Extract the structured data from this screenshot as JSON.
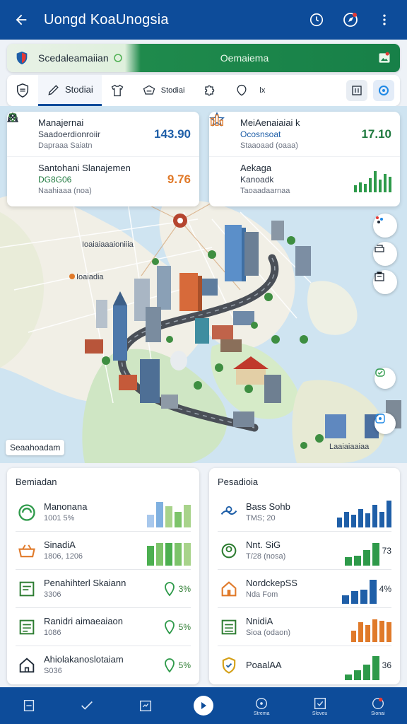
{
  "header": {
    "title": "Uongd KoaUnogsia",
    "icons": [
      "back-arrow-icon",
      "clock-icon",
      "compass-icon",
      "more-vert-icon"
    ]
  },
  "banner": {
    "left_label": "Scedaleamaiian",
    "center_label": "Oemaiema"
  },
  "tabs": [
    {
      "label": "Stodiai",
      "icon": "pencil-icon",
      "active": true
    },
    {
      "label": "",
      "icon": "shirt-icon"
    },
    {
      "label": "Stodiai",
      "icon": "cart-icon"
    },
    {
      "label": "",
      "icon": "puzzle-icon"
    },
    {
      "label": "lx",
      "icon": "shield-outline-icon"
    }
  ],
  "map_stats": {
    "left": [
      {
        "title": "Manajernai",
        "line2": "Saadoerdionroiir",
        "line3": "Dapraaa Saiatn",
        "value": "143.90",
        "value_color": "#1f5fa8"
      },
      {
        "title": "Santohani Slanajemen",
        "line2": "DG8G06",
        "line3": "Naahiaaa (noa)",
        "value": "9.76",
        "value_color": "#e07a2a"
      }
    ],
    "right": [
      {
        "title": "MeiAenaiaiai k",
        "line2": "Ocosnsoat",
        "line3": "Staaoaad (oaaa)",
        "value": "17.10",
        "value_color": "#1f7a3f"
      },
      {
        "title": "Aekaga",
        "line2": "Kanoadk",
        "line3": "Taoaadaarnaa",
        "value": ""
      }
    ]
  },
  "map": {
    "place_labels": [
      "Ioaiaiaaaioniiia",
      "Ioaiadia",
      "Laaiaiaaiaa"
    ],
    "chip_label": "Seaahoadam",
    "fab_icons": [
      "dots-icon",
      "layers-icon",
      "building-icon",
      "chat-icon",
      "location-icon"
    ]
  },
  "left_panel": {
    "title": "Bemiadan",
    "rows": [
      {
        "icon": "globe-icon",
        "title": "Manonana",
        "sub": "1001 5%",
        "pct": "",
        "bars": [
          0.45,
          0.9,
          0.75,
          0.55,
          0.8
        ],
        "colors": [
          "#a8c8ec",
          "#7fb0e0",
          "#a8d38b",
          "#7cc36a",
          "#a8d38b"
        ]
      },
      {
        "icon": "basket-icon",
        "title": "SinadiA",
        "sub": "1806, 1206",
        "pct": "",
        "bars": [
          0.7,
          0.8,
          0.8,
          0.8,
          0.8
        ],
        "colors": [
          "#4caf50",
          "#7cc36a",
          "#4caf50",
          "#7cc36a",
          "#a8d38b"
        ]
      },
      {
        "icon": "doc-icon",
        "title": "Penahihterl Skaiann",
        "sub": "3306",
        "pct": "3%",
        "bars": [],
        "colors": []
      },
      {
        "icon": "form-icon",
        "title": "Ranidri aimaeaiaon",
        "sub": "1086",
        "pct": "5%",
        "bars": [],
        "colors": []
      },
      {
        "icon": "house-icon",
        "title": "Ahiolakanoslotaiam",
        "sub": "S036",
        "pct": "5%",
        "bars": [],
        "colors": []
      }
    ]
  },
  "right_panel": {
    "title": "Pesadioia",
    "rows": [
      {
        "icon": "hands-icon",
        "title": "Bass Sohb",
        "sub": "TMS; 20",
        "pct": "",
        "bars": [
          0.35,
          0.55,
          0.45,
          0.65,
          0.5,
          0.8,
          0.55,
          0.95
        ],
        "colors": [
          "#1f5fa8",
          "#1f5fa8",
          "#1f5fa8",
          "#1f5fa8",
          "#1f5fa8",
          "#1f5fa8",
          "#1f5fa8",
          "#1f5fa8"
        ]
      },
      {
        "icon": "gear-person-icon",
        "title": "Nnt. SiG",
        "sub": "T/28 (nosa)",
        "pct": "73",
        "bars": [
          0.3,
          0.35,
          0.55,
          0.8
        ],
        "colors": [
          "#2e9a4a",
          "#2e9a4a",
          "#2e9a4a",
          "#2e9a4a"
        ]
      },
      {
        "icon": "house-orange-icon",
        "title": "NordckepSS",
        "sub": "Nda Fom",
        "pct": "4%",
        "bars": [
          0.3,
          0.45,
          0.5,
          0.85
        ],
        "colors": [
          "#1f5fa8",
          "#1f5fa8",
          "#1f5fa8",
          "#1f5fa8"
        ]
      },
      {
        "icon": "chart-icon",
        "title": "NnidiA",
        "sub": "Sioa (odaon)",
        "pct": "",
        "bars": [
          0.4,
          0.7,
          0.6,
          0.8,
          0.75,
          0.7
        ],
        "colors": [
          "#e07a2a",
          "#e07a2a",
          "#e07a2a",
          "#e07a2a",
          "#e07a2a",
          "#e07a2a"
        ]
      },
      {
        "icon": "shield-gold-icon",
        "title": "PoaalAA",
        "sub": "",
        "pct": "36",
        "bars": [
          0.2,
          0.35,
          0.55,
          0.85
        ],
        "colors": [
          "#2e9a4a",
          "#2e9a4a",
          "#2e9a4a",
          "#2e9a4a"
        ]
      }
    ]
  },
  "bottom_nav": [
    {
      "icon": "doc-nav-icon",
      "label": ""
    },
    {
      "icon": "check-nav-icon",
      "label": ""
    },
    {
      "icon": "map-nav-icon",
      "label": ""
    },
    {
      "icon": "play-nav-icon",
      "label": ""
    },
    {
      "icon": "compass-nav-icon",
      "label": "Strema"
    },
    {
      "icon": "checklist-nav-icon",
      "label": "Sloveu"
    },
    {
      "icon": "location-nav-icon",
      "label": "Sionai"
    }
  ],
  "colors": {
    "primary": "#0d4c9a",
    "accent_green": "#178048",
    "map_water": "#cfe4f1"
  }
}
